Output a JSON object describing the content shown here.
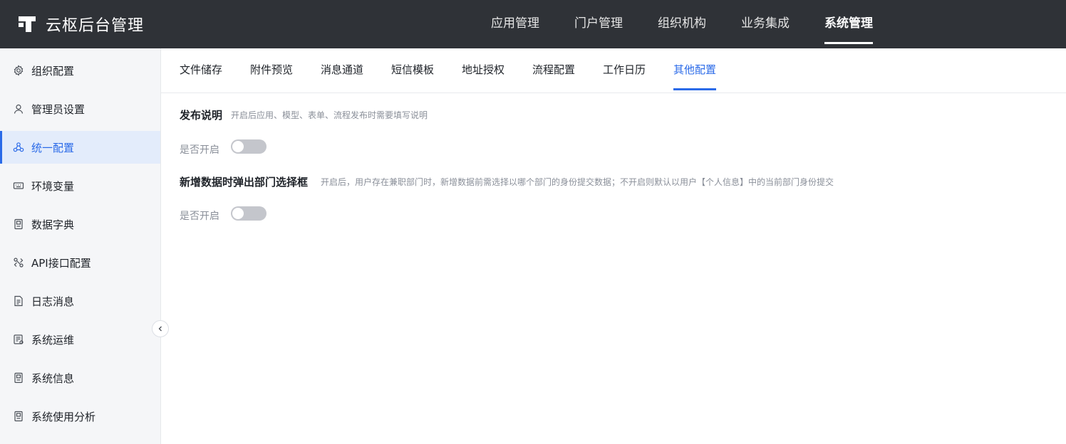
{
  "app": {
    "title": "云枢后台管理"
  },
  "top_nav": [
    {
      "label": "应用管理",
      "active": false
    },
    {
      "label": "门户管理",
      "active": false
    },
    {
      "label": "组织机构",
      "active": false
    },
    {
      "label": "业务集成",
      "active": false
    },
    {
      "label": "系统管理",
      "active": true
    }
  ],
  "sidebar": {
    "items": [
      {
        "label": "组织配置",
        "icon": "gear-icon",
        "active": false
      },
      {
        "label": "管理员设置",
        "icon": "user-icon",
        "active": false
      },
      {
        "label": "统一配置",
        "icon": "nodes-icon",
        "active": true
      },
      {
        "label": "环境变量",
        "icon": "keyboard-icon",
        "active": false
      },
      {
        "label": "数据字典",
        "icon": "book-icon",
        "active": false
      },
      {
        "label": "API接口配置",
        "icon": "api-icon",
        "active": false
      },
      {
        "label": "日志消息",
        "icon": "document-icon",
        "active": false
      },
      {
        "label": "系统运维",
        "icon": "monitor-icon",
        "active": false
      },
      {
        "label": "系统信息",
        "icon": "info-card-icon",
        "active": false
      },
      {
        "label": "系统使用分析",
        "icon": "analysis-icon",
        "active": false
      }
    ]
  },
  "tabs": [
    {
      "label": "文件储存",
      "active": false
    },
    {
      "label": "附件预览",
      "active": false
    },
    {
      "label": "消息通道",
      "active": false
    },
    {
      "label": "短信模板",
      "active": false
    },
    {
      "label": "地址授权",
      "active": false
    },
    {
      "label": "流程配置",
      "active": false
    },
    {
      "label": "工作日历",
      "active": false
    },
    {
      "label": "其他配置",
      "active": true
    }
  ],
  "settings": [
    {
      "title": "发布说明",
      "description": "开启后应用、模型、表单、流程发布时需要填写说明",
      "toggle_label": "是否开启",
      "enabled": false
    },
    {
      "title": "新增数据时弹出部门选择框",
      "description": "开启后，用户存在兼职部门时，新增数据前需选择以哪个部门的身份提交数据；不开启则默认以用户【个人信息】中的当前部门身份提交",
      "toggle_label": "是否开启",
      "enabled": false
    }
  ],
  "colors": {
    "topbar": "#2f3237",
    "accent": "#2a6ae8",
    "sidebar_bg": "#f5f6f8",
    "active_item_bg": "#e3ecfb",
    "toggle_off": "#c4c6cc"
  }
}
